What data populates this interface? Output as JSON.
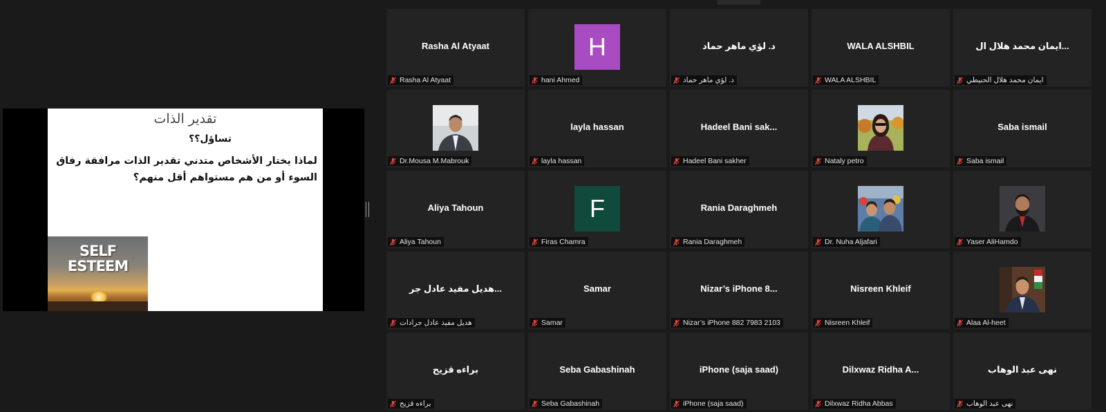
{
  "slide": {
    "title": "تقدير الذات",
    "question": "تساؤل؟؟",
    "body": "لماذا يختار الأشخاص متدني تقدير الذات مرافقة رفاق السوء أو من هم مستواهم أقل منهم؟",
    "image_text_line1": "SELF",
    "image_text_line2": "ESTEEM"
  },
  "participants": [
    {
      "display": "Rasha Al Atyaat",
      "name": "Rasha Al Atyaat",
      "type": "text"
    },
    {
      "display": "H",
      "name": "hani Ahmed",
      "type": "letter",
      "color": "#a94cc2"
    },
    {
      "display": "د. لؤي ماهر حماد",
      "name": "د. لؤي ماهر حماد",
      "type": "text",
      "rtl": true
    },
    {
      "display": "WALA ALSHBIL",
      "name": "WALA ALSHBIL",
      "type": "text"
    },
    {
      "display": "...ايمان محمد هلال ال",
      "name": "ايمان محمد هلال الحنيطي",
      "type": "text",
      "rtl": true
    },
    {
      "display": "",
      "name": "Dr.Mousa M.Mabrouk",
      "type": "photo",
      "photo": "man-suit"
    },
    {
      "display": "layla hassan",
      "name": "layla hassan",
      "type": "text"
    },
    {
      "display": "Hadeel Bani sak...",
      "name": "Hadeel Bani sakher",
      "type": "text"
    },
    {
      "display": "",
      "name": "Nataly petro",
      "type": "photo",
      "photo": "woman-outdoor"
    },
    {
      "display": "Saba ismail",
      "name": "Saba ismail",
      "type": "text"
    },
    {
      "display": "Aliya Tahoun",
      "name": "Aliya Tahoun",
      "type": "text"
    },
    {
      "display": "F",
      "name": "Firas Chamra",
      "type": "letter",
      "color": "#0f4a3c"
    },
    {
      "display": "Rania Daraghmeh",
      "name": "Rania Daraghmeh",
      "type": "text"
    },
    {
      "display": "",
      "name": "Dr. Nuha Aljafari",
      "type": "photo",
      "photo": "couple"
    },
    {
      "display": "",
      "name": "Yaser AliHamdo",
      "type": "photo",
      "photo": "man-beard"
    },
    {
      "display": "...هديل مفيد عادل جر",
      "name": "هديل مفيد عادل جرادات",
      "type": "text",
      "rtl": true
    },
    {
      "display": "Samar",
      "name": "Samar",
      "type": "text"
    },
    {
      "display": "Nizar’s iPhone 8...",
      "name": "Nizar’s iPhone 882 7983 2103",
      "type": "text"
    },
    {
      "display": "Nisreen Khleif",
      "name": "Nisreen Khleif",
      "type": "text"
    },
    {
      "display": "",
      "name": "Alaa Al-heet",
      "type": "photo",
      "photo": "man-office"
    },
    {
      "display": "براءه قزيح",
      "name": "براءه قزيح",
      "type": "text",
      "rtl": true
    },
    {
      "display": "Seba Gabashinah",
      "name": "Seba Gabashinah",
      "type": "text"
    },
    {
      "display": "iPhone (saja saad)",
      "name": "iPhone (saja saad)",
      "type": "text"
    },
    {
      "display": "Dilxwaz Ridha A...",
      "name": "Dilxwaz Ridha Abbas",
      "type": "text"
    },
    {
      "display": "نهى عبد الوهاب",
      "name": "نهى عبد الوهاب",
      "type": "text",
      "rtl": true
    }
  ],
  "colors": {
    "background": "#1a1a1a",
    "tile": "#232323",
    "muted_icon": "#e0443e"
  }
}
